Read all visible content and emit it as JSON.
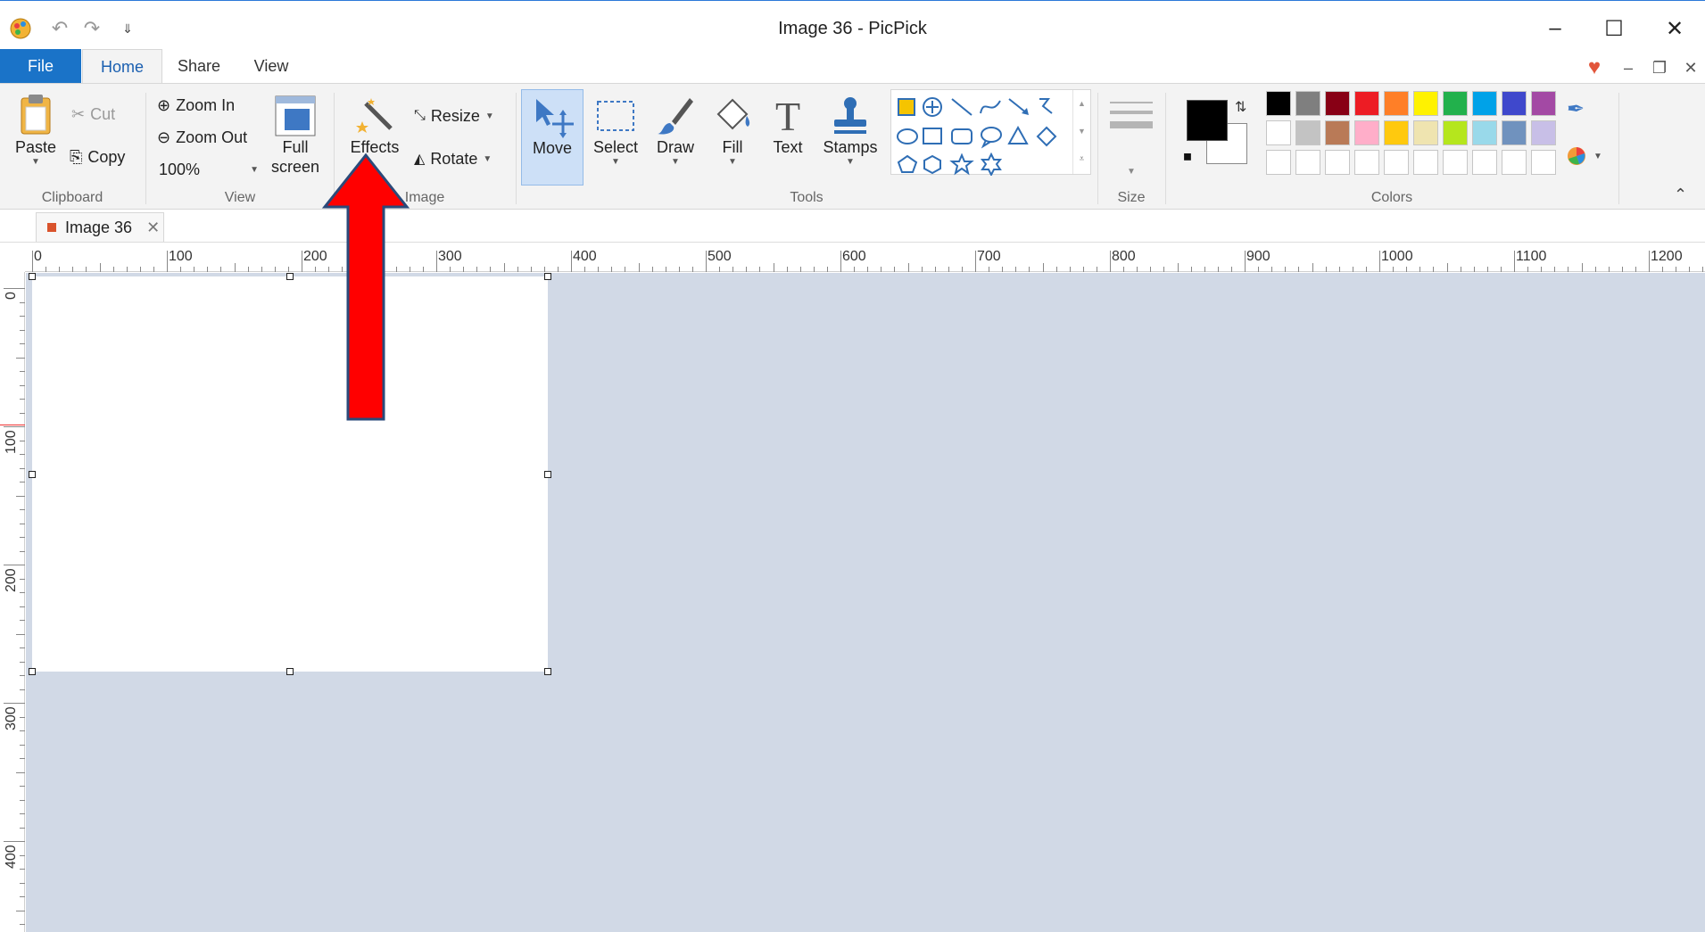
{
  "window": {
    "title": "Image 36 - PicPick",
    "minimize": "–",
    "maximize": "☐",
    "close": "✕"
  },
  "quick_access": {
    "undo": "↶",
    "redo": "↷",
    "customize": "⇓"
  },
  "tabs": {
    "file": "File",
    "home": "Home",
    "share": "Share",
    "view": "View"
  },
  "mdi_controls": {
    "favorite": "♥",
    "minimize": "–",
    "restore": "❐",
    "close": "✕",
    "collapse_ribbon": "⌃"
  },
  "clipboard": {
    "group_label": "Clipboard",
    "paste": "Paste",
    "cut": "Cut",
    "copy": "Copy"
  },
  "view_group": {
    "group_label": "View",
    "zoom_in": "Zoom In",
    "zoom_out": "Zoom Out",
    "zoom_level": "100%",
    "full_screen_line1": "Full",
    "full_screen_line2": "screen"
  },
  "image_group": {
    "group_label": "Image",
    "effects": "Effects",
    "resize": "Resize",
    "rotate": "Rotate"
  },
  "tools_group": {
    "group_label": "Tools",
    "move": "Move",
    "select": "Select",
    "draw": "Draw",
    "fill": "Fill",
    "text": "Text",
    "stamps": "Stamps",
    "shapes": [
      "rectangle-select-shape",
      "crosshair-shape",
      "line-shape",
      "curve-shape",
      "arrow-shape",
      "connector-shape",
      "ellipse-shape",
      "rectangle-shape",
      "rounded-rectangle-shape",
      "speech-bubble-shape",
      "triangle-shape",
      "diamond-shape",
      "pentagon-shape",
      "hexagon-shape",
      "star-shape",
      "six-point-star-shape"
    ]
  },
  "size_group": {
    "group_label": "Size"
  },
  "colors_group": {
    "group_label": "Colors",
    "foreground": "#000000",
    "background": "#ffffff",
    "accent": "#3a6fc2",
    "row1": [
      "#000000",
      "#7f7f7f",
      "#880015",
      "#ed1c24",
      "#ff7f27",
      "#fff200",
      "#22b14c",
      "#00a2e8",
      "#3f48cc",
      "#a349a4"
    ],
    "row2": [
      "#ffffff",
      "#c3c3c3",
      "#b97a57",
      "#ffaec9",
      "#ffc90e",
      "#efe4b0",
      "#b5e61d",
      "#99d9ea",
      "#7092be",
      "#c8bfe7"
    ],
    "row3": [
      "#ffffff",
      "#ffffff",
      "#ffffff",
      "#ffffff",
      "#ffffff",
      "#ffffff",
      "#ffffff",
      "#ffffff",
      "#ffffff",
      "#ffffff"
    ]
  },
  "document": {
    "tab_title": "Image 36",
    "tab_close": "✕"
  },
  "rulers": {
    "horizontal": [
      "0",
      "100",
      "200",
      "300",
      "400",
      "500",
      "600",
      "700",
      "800",
      "900",
      "1000",
      "1100",
      "1200"
    ],
    "vertical": [
      "0",
      "100",
      "200",
      "300",
      "400"
    ]
  },
  "annotation": {
    "arrow_color": "#ff0000"
  }
}
